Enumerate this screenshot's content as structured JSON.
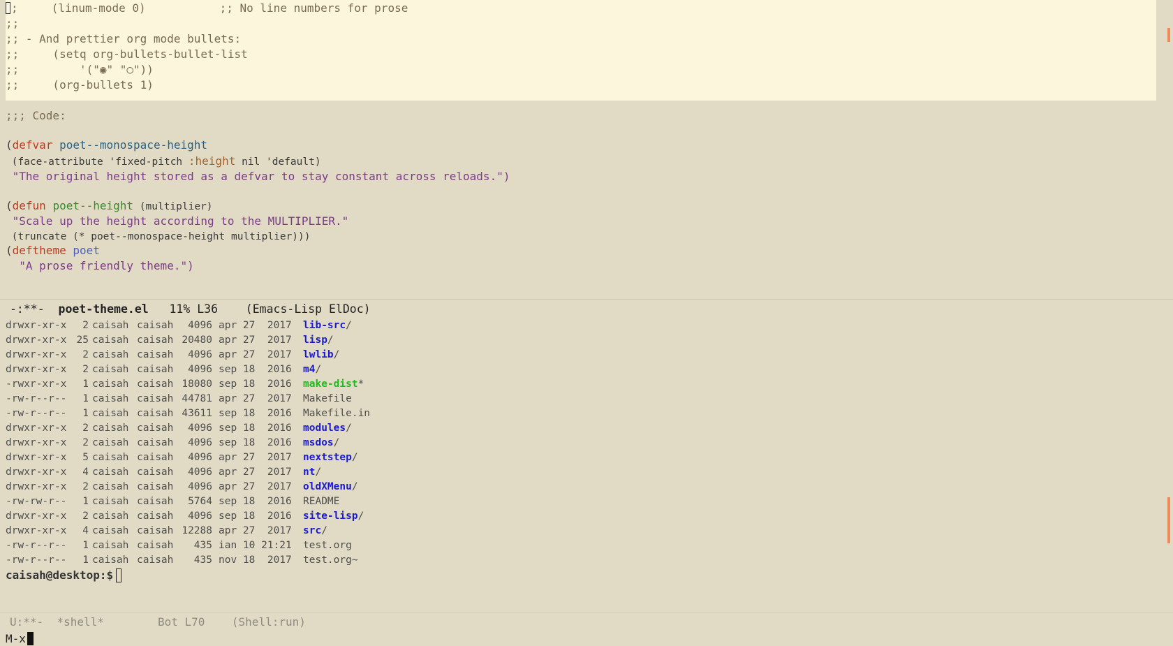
{
  "editor": {
    "comment_lines": [
      ";     (linum-mode 0)           ;; No line numbers for prose",
      ";;",
      ";; - And prettier org mode bullets:",
      ";;     (setq org-bullets-bullet-list",
      ";;         '(\"◉\" \"○\"))",
      ";;     (org-bullets 1)"
    ],
    "first_char": ";",
    "code_header": ";;; Code:",
    "defvar": {
      "keyword": "defvar",
      "name": "poet--monospace-height",
      "body_pre": " (face-attribute 'fixed-pitch ",
      "body_kw": ":height",
      "body_post": " nil 'default)",
      "doc": " \"The original height stored as a defvar to stay constant across reloads.\")"
    },
    "defun": {
      "keyword": "defun",
      "name": "poet--height",
      "args": " (multiplier)",
      "doc": " \"Scale up the height according to the MULTIPLIER.\"",
      "body": " (truncate (* poet--monospace-height multiplier)))"
    },
    "deftheme": {
      "keyword": "deftheme",
      "name": "poet",
      "doc": "  \"A prose friendly theme.\")"
    }
  },
  "modeline_top": {
    "status": "-:**-",
    "buffer": "poet-theme.el",
    "position": "11% L36",
    "modes": "(Emacs-Lisp ElDoc)"
  },
  "shell": {
    "rows": [
      {
        "perm": "drwxr-xr-x",
        "links": "2",
        "owner": "caisah",
        "group": "caisah",
        "size": "4096",
        "date": "apr 27  2017",
        "name": "lib-src",
        "suffix": "/",
        "kind": "dir"
      },
      {
        "perm": "drwxr-xr-x",
        "links": "25",
        "owner": "caisah",
        "group": "caisah",
        "size": "20480",
        "date": "apr 27  2017",
        "name": "lisp",
        "suffix": "/",
        "kind": "dir"
      },
      {
        "perm": "drwxr-xr-x",
        "links": "2",
        "owner": "caisah",
        "group": "caisah",
        "size": "4096",
        "date": "apr 27  2017",
        "name": "lwlib",
        "suffix": "/",
        "kind": "dir"
      },
      {
        "perm": "drwxr-xr-x",
        "links": "2",
        "owner": "caisah",
        "group": "caisah",
        "size": "4096",
        "date": "sep 18  2016",
        "name": "m4",
        "suffix": "/",
        "kind": "dir"
      },
      {
        "perm": "-rwxr-xr-x",
        "links": "1",
        "owner": "caisah",
        "group": "caisah",
        "size": "18080",
        "date": "sep 18  2016",
        "name": "make-dist",
        "suffix": "*",
        "kind": "exec"
      },
      {
        "perm": "-rw-r--r--",
        "links": "1",
        "owner": "caisah",
        "group": "caisah",
        "size": "44781",
        "date": "apr 27  2017",
        "name": "Makefile",
        "suffix": "",
        "kind": "file"
      },
      {
        "perm": "-rw-r--r--",
        "links": "1",
        "owner": "caisah",
        "group": "caisah",
        "size": "43611",
        "date": "sep 18  2016",
        "name": "Makefile.in",
        "suffix": "",
        "kind": "file"
      },
      {
        "perm": "drwxr-xr-x",
        "links": "2",
        "owner": "caisah",
        "group": "caisah",
        "size": "4096",
        "date": "sep 18  2016",
        "name": "modules",
        "suffix": "/",
        "kind": "dir"
      },
      {
        "perm": "drwxr-xr-x",
        "links": "2",
        "owner": "caisah",
        "group": "caisah",
        "size": "4096",
        "date": "sep 18  2016",
        "name": "msdos",
        "suffix": "/",
        "kind": "dir"
      },
      {
        "perm": "drwxr-xr-x",
        "links": "5",
        "owner": "caisah",
        "group": "caisah",
        "size": "4096",
        "date": "apr 27  2017",
        "name": "nextstep",
        "suffix": "/",
        "kind": "dir"
      },
      {
        "perm": "drwxr-xr-x",
        "links": "4",
        "owner": "caisah",
        "group": "caisah",
        "size": "4096",
        "date": "apr 27  2017",
        "name": "nt",
        "suffix": "/",
        "kind": "dir"
      },
      {
        "perm": "drwxr-xr-x",
        "links": "2",
        "owner": "caisah",
        "group": "caisah",
        "size": "4096",
        "date": "apr 27  2017",
        "name": "oldXMenu",
        "suffix": "/",
        "kind": "dir"
      },
      {
        "perm": "-rw-rw-r--",
        "links": "1",
        "owner": "caisah",
        "group": "caisah",
        "size": "5764",
        "date": "sep 18  2016",
        "name": "README",
        "suffix": "",
        "kind": "file"
      },
      {
        "perm": "drwxr-xr-x",
        "links": "2",
        "owner": "caisah",
        "group": "caisah",
        "size": "4096",
        "date": "sep 18  2016",
        "name": "site-lisp",
        "suffix": "/",
        "kind": "dir"
      },
      {
        "perm": "drwxr-xr-x",
        "links": "4",
        "owner": "caisah",
        "group": "caisah",
        "size": "12288",
        "date": "apr 27  2017",
        "name": "src",
        "suffix": "/",
        "kind": "dir"
      },
      {
        "perm": "-rw-r--r--",
        "links": "1",
        "owner": "caisah",
        "group": "caisah",
        "size": "435",
        "date": "ian 10 21:21",
        "name": "test.org",
        "suffix": "",
        "kind": "file"
      },
      {
        "perm": "-rw-r--r--",
        "links": "1",
        "owner": "caisah",
        "group": "caisah",
        "size": "435",
        "date": "nov 18  2017",
        "name": "test.org~",
        "suffix": "",
        "kind": "file"
      }
    ],
    "prompt": "caisah@desktop:$"
  },
  "modeline_bottom": {
    "status": "U:**-",
    "buffer": "*shell*",
    "position": "Bot L70",
    "modes": "(Shell:run)"
  },
  "minibuffer": {
    "text": "M-x"
  },
  "colors": {
    "background": "#e1dbc5",
    "comment_highlight": "#fbf6dc",
    "directory": "#1a1ad0",
    "executable": "#1dbb1d",
    "keyword": "#c0391d",
    "string": "#7b3a8a",
    "scroll_marker": "#ef8a5a"
  }
}
